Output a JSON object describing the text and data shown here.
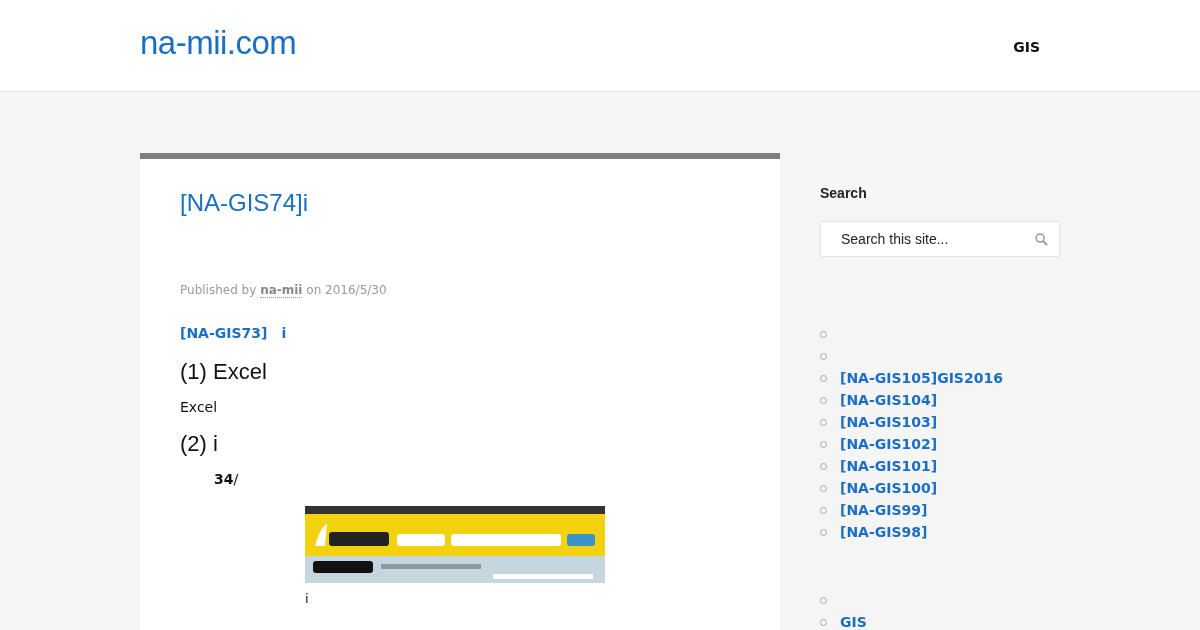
{
  "header": {
    "site_title": "na-mii.com",
    "nav": [
      {
        "label": "GIS"
      }
    ]
  },
  "post": {
    "title": "[NA-GIS74]i",
    "meta": {
      "prefix": "Published by",
      "author": "na-mii",
      "middle": "on",
      "date": "2016/5/30"
    },
    "prev_link": "[NA-GIS73]　i",
    "sections": [
      {
        "kind": "heading",
        "text": "(1) Excel"
      },
      {
        "kind": "paragraph",
        "text": "Excel"
      },
      {
        "kind": "heading",
        "text": "(2) i"
      },
      {
        "kind": "note",
        "text": "**34**/"
      },
      {
        "kind": "figure",
        "caption": "i"
      }
    ]
  },
  "sidebar": {
    "search": {
      "title": "Search",
      "placeholder": "Search this site..."
    },
    "recent_posts": [
      "[NA-GIS105]GIS2016",
      "[NA-GIS104]",
      "[NA-GIS103]",
      "[NA-GIS102]",
      "[NA-GIS101]",
      "[NA-GIS100]",
      "[NA-GIS99]",
      "[NA-GIS98]"
    ],
    "categories": [
      "GIS"
    ]
  }
}
